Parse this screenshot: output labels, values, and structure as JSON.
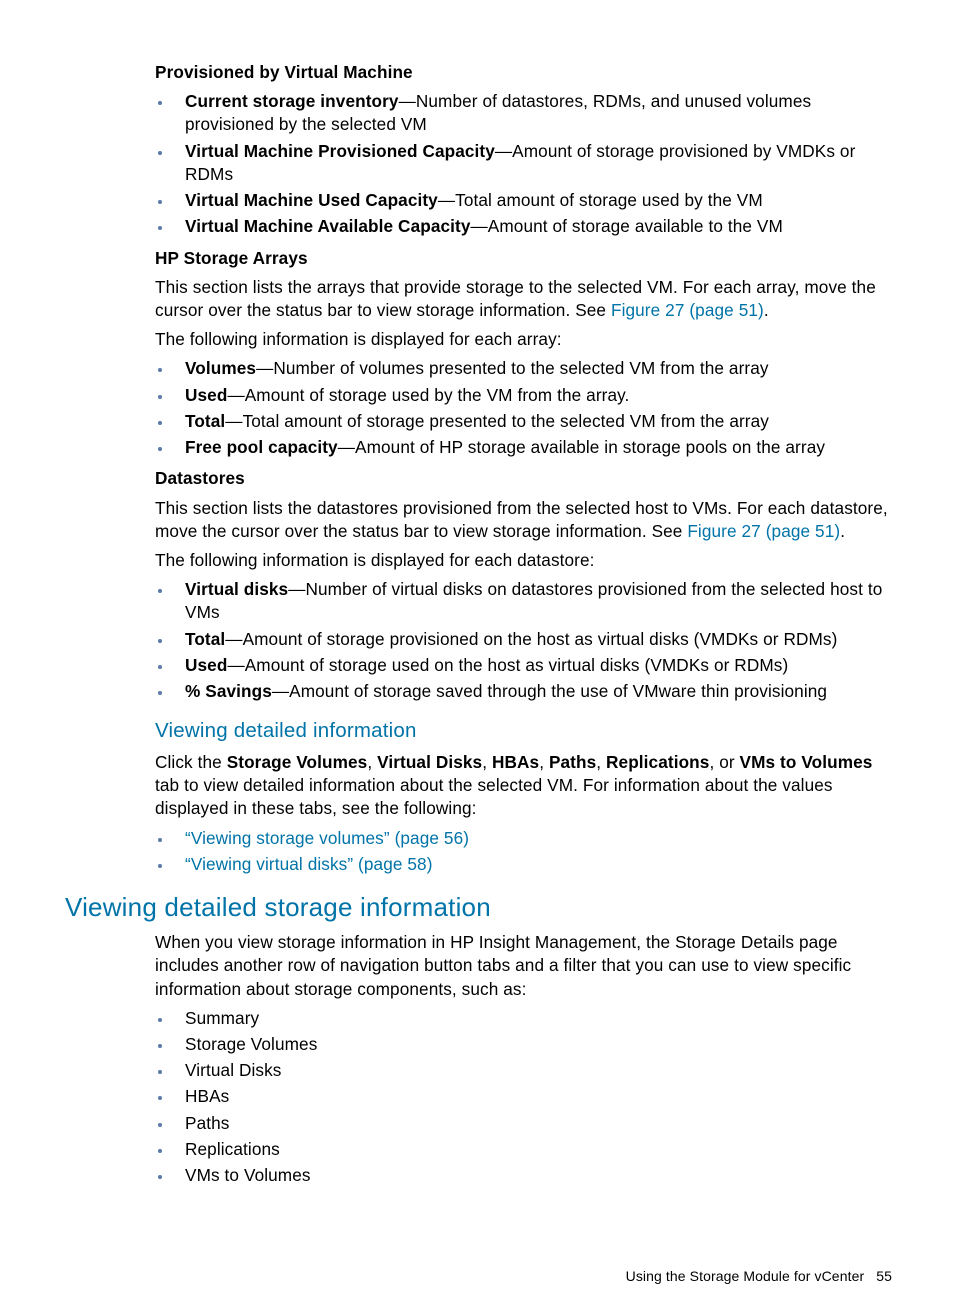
{
  "s1": {
    "head": "Provisioned by Virtual Machine",
    "items": [
      {
        "term": "Current storage inventory",
        "desc": "—Number of datastores, RDMs, and unused volumes provisioned by the selected VM"
      },
      {
        "term": "Virtual Machine Provisioned Capacity",
        "desc": "—Amount of storage provisioned by VMDKs or RDMs"
      },
      {
        "term": "Virtual Machine Used Capacity",
        "desc": "—Total amount of storage used by the VM"
      },
      {
        "term": "Virtual Machine Available Capacity",
        "desc": "—Amount of storage available to the VM"
      }
    ]
  },
  "s2": {
    "head": "HP Storage Arrays",
    "p1a": "This section lists the arrays that provide storage to the selected VM. For each array, move the cursor over the status bar to view storage information. See ",
    "p1link": "Figure 27 (page 51)",
    "p1b": ".",
    "p2": "The following information is displayed for each array:",
    "items": [
      {
        "term": "Volumes",
        "desc": "—Number of volumes presented to the selected VM from the array"
      },
      {
        "term": "Used",
        "desc": "—Amount of storage used by the VM from the array."
      },
      {
        "term": "Total",
        "desc": "—Total amount of storage presented to the selected VM from the array"
      },
      {
        "term": "Free pool capacity",
        "desc": "—Amount of HP storage available in storage pools on the array"
      }
    ]
  },
  "s3": {
    "head": "Datastores",
    "p1a": "This section lists the datastores provisioned from the selected host to VMs. For each datastore, move the cursor over the status bar to view storage information. See ",
    "p1link": "Figure 27 (page 51)",
    "p1b": ".",
    "p2": "The following information is displayed for each datastore:",
    "items": [
      {
        "term": "Virtual disks",
        "desc": "—Number of virtual disks on datastores provisioned from the selected host to VMs"
      },
      {
        "term": "Total",
        "desc": "—Amount of storage provisioned on the host as virtual disks (VMDKs or RDMs)"
      },
      {
        "term": "Used",
        "desc": "—Amount of storage used on the host as virtual disks (VMDKs or RDMs)"
      },
      {
        "term": "% Savings",
        "desc": "—Amount of storage saved through the use of VMware thin provisioning"
      }
    ]
  },
  "s4": {
    "head": "Viewing detailed information",
    "p1a": "Click the ",
    "t1": "Storage Volumes",
    "c1": ", ",
    "t2": "Virtual Disks",
    "c2": ", ",
    "t3": "HBAs",
    "c3": ", ",
    "t4": "Paths",
    "c4": ", ",
    "t5": "Replications",
    "c5": ", or ",
    "t6": "VMs to Volumes",
    "p1b": " tab to view detailed information about the selected VM. For information about the values displayed in these tabs, see the following:",
    "links": [
      "“Viewing storage volumes” (page 56)",
      "“Viewing virtual disks” (page 58)"
    ]
  },
  "s5": {
    "head": "Viewing detailed storage information",
    "p1": "When you view storage information in HP Insight Management, the Storage Details page includes another row of navigation button tabs and a filter that you can use to view specific information about storage components, such as:",
    "items": [
      "Summary",
      "Storage Volumes",
      "Virtual Disks",
      "HBAs",
      "Paths",
      "Replications",
      "VMs to Volumes"
    ]
  },
  "footer": {
    "text": "Using the Storage Module for vCenter",
    "page": "55"
  }
}
